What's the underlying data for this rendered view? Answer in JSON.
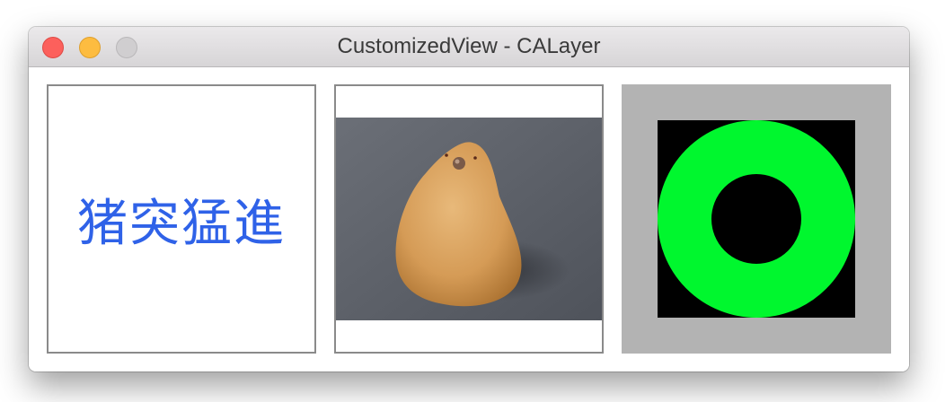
{
  "window": {
    "title": "CustomizedView - CALayer"
  },
  "titlebar": {
    "buttons": [
      "close-icon",
      "minimize-icon",
      "zoom-icon"
    ]
  },
  "panels": [
    {
      "kind": "text-layer",
      "text": "猪突猛進",
      "text_color": "#2f62e8",
      "border_color": "#8a8a8a"
    },
    {
      "kind": "image-layer",
      "image": "clay-bird-figurine-photo",
      "border_color": "#8a8a8a"
    },
    {
      "kind": "shape-layer",
      "shape": "ring",
      "background_color": "#b3b3b3",
      "fill_color": "#000000",
      "ring_color": "#00f72e"
    }
  ]
}
